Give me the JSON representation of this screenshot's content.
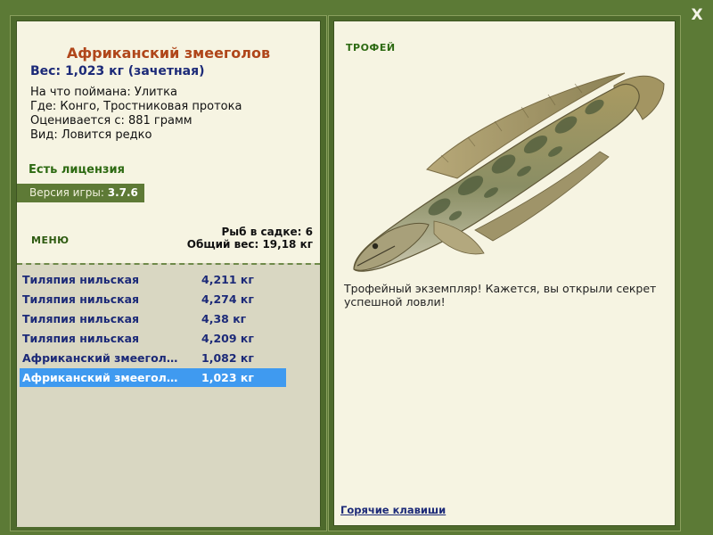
{
  "close_label": "X",
  "fish": {
    "title": "Африканский змееголов",
    "weight_line": "Вес: 1,023 кг (зачетная)",
    "details": [
      "На что поймана: Улитка",
      "Где: Конго, Тростниковая протока",
      "Оценивается с: 881 грамм",
      "Вид: Ловится редко"
    ]
  },
  "license_text": "Есть лицензия",
  "version": {
    "label": "Версия игры: ",
    "value": "3.7.6"
  },
  "menu_label": "МЕНЮ",
  "keep": {
    "count_line": "Рыб в садке: 6",
    "total_line": "Общий вес: 19,18 кг"
  },
  "catch_list": [
    {
      "name": "Тиляпия нильская",
      "weight": "4,211 кг",
      "selected": false
    },
    {
      "name": "Тиляпия нильская",
      "weight": "4,274 кг",
      "selected": false
    },
    {
      "name": "Тиляпия нильская",
      "weight": "4,38 кг",
      "selected": false
    },
    {
      "name": "Тиляпия нильская",
      "weight": "4,209 кг",
      "selected": false
    },
    {
      "name": "Африканский змееголо...",
      "weight": "1,082 кг",
      "selected": false
    },
    {
      "name": "Африканский змееголо...",
      "weight": "1,023 кг",
      "selected": true
    }
  ],
  "trophy": {
    "label": "ТРОФЕЙ",
    "description": "Трофейный экземпляр! Кажется, вы открыли секрет успешной ловли!"
  },
  "hotkeys_link": "Горячие клавиши",
  "colors": {
    "background": "#5c7a36",
    "panel": "#f6f4e2",
    "title": "#b0461a",
    "accent_text": "#1c2a78",
    "selected_row": "#3f9af0"
  }
}
